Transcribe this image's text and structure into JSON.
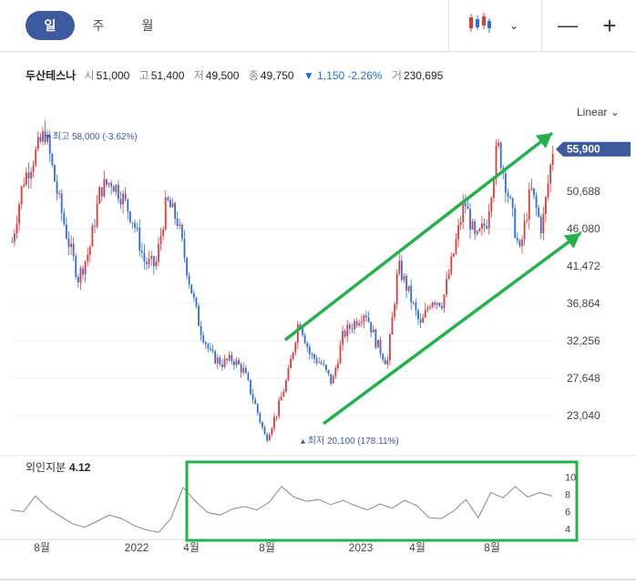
{
  "tabs": [
    {
      "label": "일",
      "active": true
    },
    {
      "label": "주",
      "active": false
    },
    {
      "label": "월",
      "active": false
    }
  ],
  "controls": {
    "chart_type_icon": "candlestick-icon",
    "dropdown_icon": "chevron-down-icon",
    "zoom_out": "—",
    "zoom_in": "+"
  },
  "quote": {
    "name": "두산테스나",
    "open_label": "시",
    "open": "51,000",
    "high_label": "고",
    "high": "51,400",
    "low_label": "저",
    "low": "49,500",
    "close_label": "종",
    "close": "49,750",
    "change": "▼ 1,150",
    "change_pct": "-2.26%",
    "volume_label": "거",
    "volume": "230,695"
  },
  "scale_button": "Linear",
  "colors": {
    "up": "#e03a3a",
    "down": "#2f6fd6",
    "accent": "#3d5a9e",
    "annotation": "#22b14c"
  },
  "chart_data": [
    {
      "type": "candlestick",
      "title": "",
      "y_ticks": [
        23040,
        27648,
        32256,
        36864,
        41472,
        46080,
        50688
      ],
      "y_tick_labels": [
        "23,040",
        "27,648",
        "32,256",
        "36,864",
        "41,472",
        "46,080",
        "50,688"
      ],
      "ylim": [
        19000,
        62500
      ],
      "x_tick_labels": [
        "8월",
        "2022",
        "4월",
        "8월",
        "2023",
        "4월",
        "8월"
      ],
      "current_price_label": "55,900",
      "high_marker": {
        "label": "최고",
        "value": "58,000",
        "pct": "(-3.62%)"
      },
      "low_marker": {
        "label": "최저",
        "value": "20,100",
        "pct": "(178.11%)"
      },
      "close_trend": [
        [
          "2021-06",
          44500
        ],
        [
          "2021-07",
          52000
        ],
        [
          "2021-08",
          55000
        ],
        [
          "2021-08",
          58000
        ],
        [
          "2021-09",
          51000
        ],
        [
          "2021-10",
          45000
        ],
        [
          "2021-10",
          40000
        ],
        [
          "2021-11",
          43500
        ],
        [
          "2021-12",
          51000
        ],
        [
          "2021-12",
          52000
        ],
        [
          "2022-01",
          50000
        ],
        [
          "2022-02",
          47000
        ],
        [
          "2022-02",
          42000
        ],
        [
          "2022-03",
          41500
        ],
        [
          "2022-03",
          49500
        ],
        [
          "2022-04",
          47000
        ],
        [
          "2022-05",
          40000
        ],
        [
          "2022-05",
          34000
        ],
        [
          "2022-06",
          30500
        ],
        [
          "2022-06",
          29500
        ],
        [
          "2022-07",
          30000
        ],
        [
          "2022-08",
          28500
        ],
        [
          "2022-09",
          24500
        ],
        [
          "2022-09",
          20100
        ],
        [
          "2022-10",
          23500
        ],
        [
          "2022-10",
          28000
        ],
        [
          "2022-11",
          35000
        ],
        [
          "2022-11",
          30500
        ],
        [
          "2022-12",
          29500
        ],
        [
          "2023-01",
          27000
        ],
        [
          "2023-01",
          33000
        ],
        [
          "2023-02",
          34500
        ],
        [
          "2023-02",
          36000
        ],
        [
          "2023-03",
          32000
        ],
        [
          "2023-04",
          29500
        ],
        [
          "2023-04",
          41500
        ],
        [
          "2023-05",
          38000
        ],
        [
          "2023-05",
          34000
        ],
        [
          "2023-06",
          37500
        ],
        [
          "2023-06",
          37000
        ],
        [
          "2023-07",
          43000
        ],
        [
          "2023-07",
          49500
        ],
        [
          "2023-08",
          44500
        ],
        [
          "2023-08",
          47000
        ],
        [
          "2023-09",
          56500
        ],
        [
          "2023-09",
          50000
        ],
        [
          "2023-10",
          43000
        ],
        [
          "2023-10",
          51000
        ],
        [
          "2023-11",
          46000
        ],
        [
          "2023-11",
          55900
        ]
      ]
    },
    {
      "type": "line",
      "title": "외인지분",
      "current_value": "4.12",
      "y_ticks": [
        4,
        6,
        8,
        10
      ],
      "ylim": [
        3,
        11
      ],
      "values": [
        6.2,
        6.0,
        7.8,
        6.4,
        5.5,
        4.6,
        4.2,
        4.9,
        5.6,
        5.2,
        4.4,
        3.9,
        3.6,
        5.2,
        8.8,
        7.2,
        5.9,
        5.6,
        6.3,
        6.6,
        6.2,
        7.1,
        8.9,
        7.7,
        7.2,
        7.4,
        6.8,
        7.3,
        6.7,
        6.2,
        6.9,
        6.4,
        7.3,
        6.7,
        5.3,
        5.2,
        6.1,
        7.4,
        5.3,
        8.2,
        7.6,
        8.9,
        7.7,
        8.2,
        7.8
      ]
    }
  ],
  "annotations": {
    "upper_trendline": "green-arrow",
    "lower_trendline": "green-arrow",
    "highlight_box": "green-rectangle"
  }
}
